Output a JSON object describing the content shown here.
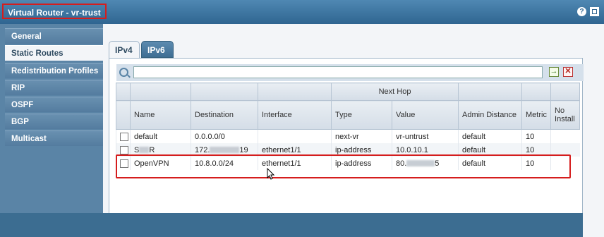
{
  "window": {
    "title": "Virtual Router - vr-trust"
  },
  "header_icons": {
    "help": "?",
    "help_icon": "help-icon",
    "window_icon": "minimize-icon"
  },
  "sidebar": {
    "items": [
      {
        "label": "General"
      },
      {
        "label": "Static Routes"
      },
      {
        "label": "Redistribution Profiles"
      },
      {
        "label": "RIP"
      },
      {
        "label": "OSPF"
      },
      {
        "label": "BGP"
      },
      {
        "label": "Multicast"
      }
    ],
    "active": "Static Routes"
  },
  "tabs": [
    {
      "label": "IPv4"
    },
    {
      "label": "IPv6"
    }
  ],
  "search": {
    "value": "",
    "placeholder": "",
    "go_symbol": "→",
    "clear_symbol": "✕"
  },
  "table": {
    "group_header": "Next Hop",
    "columns": [
      "Name",
      "Destination",
      "Interface",
      "Type",
      "Value",
      "Admin Distance",
      "Metric",
      "No Install"
    ],
    "rows": [
      {
        "name": "default",
        "destination": "0.0.0.0/0",
        "interface": "",
        "type": "next-vr",
        "value": "vr-untrust",
        "admin_distance": "default",
        "metric": "10"
      },
      {
        "name": "S",
        "name_tail": "R",
        "destination": "172.",
        "destination_tail": "19",
        "interface": "ethernet1/1",
        "type": "ip-address",
        "value": "10.0.10.1",
        "admin_distance": "default",
        "metric": "10"
      },
      {
        "name": "OpenVPN",
        "destination": "10.8.0.0/24",
        "interface": "ethernet1/1",
        "type": "ip-address",
        "value": "80.",
        "value_tail": "5",
        "admin_distance": "default",
        "metric": "10"
      }
    ]
  },
  "colors": {
    "highlight": "#d51d1d",
    "titlebar": "#2f6591",
    "sidebar": "#5a84a6"
  }
}
